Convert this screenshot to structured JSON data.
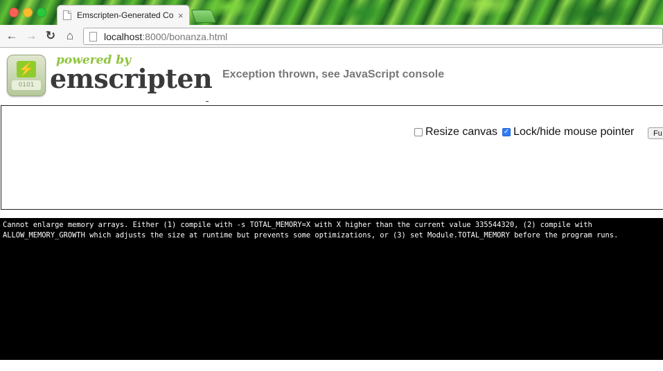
{
  "window": {
    "tab_title": "Emscripten-Generated Co",
    "tab_close": "×"
  },
  "toolbar": {
    "back_icon": "←",
    "forward_icon": "→",
    "reload_icon": "↻",
    "home_icon": "⌂",
    "url_host": "localhost",
    "url_rest": ":8000/bonanza.html"
  },
  "logo": {
    "powered_by": "powered by",
    "name": "emscripten",
    "badge_bolt": "⚡",
    "badge_label": "0101"
  },
  "status": {
    "text": "Exception thrown, see JavaScript console"
  },
  "controls": {
    "resize_label": "Resize canvas",
    "resize_checked": false,
    "lock_label": "Lock/hide mouse pointer",
    "lock_checked": true,
    "fullscreen_label": "Fu"
  },
  "console": {
    "output": "Cannot enlarge memory arrays. Either (1) compile with -s TOTAL_MEMORY=X with X higher than the current value 335544320, (2) compile with\nALLOW_MEMORY_GROWTH which adjusts the size at runtime but prevents some optimizations, or (3) set Module.TOTAL_MEMORY before the program runs."
  },
  "colors": {
    "status_text": "#777777",
    "logo_green": "#8fc43f",
    "checkbox_checked": "#2f7cf6"
  }
}
